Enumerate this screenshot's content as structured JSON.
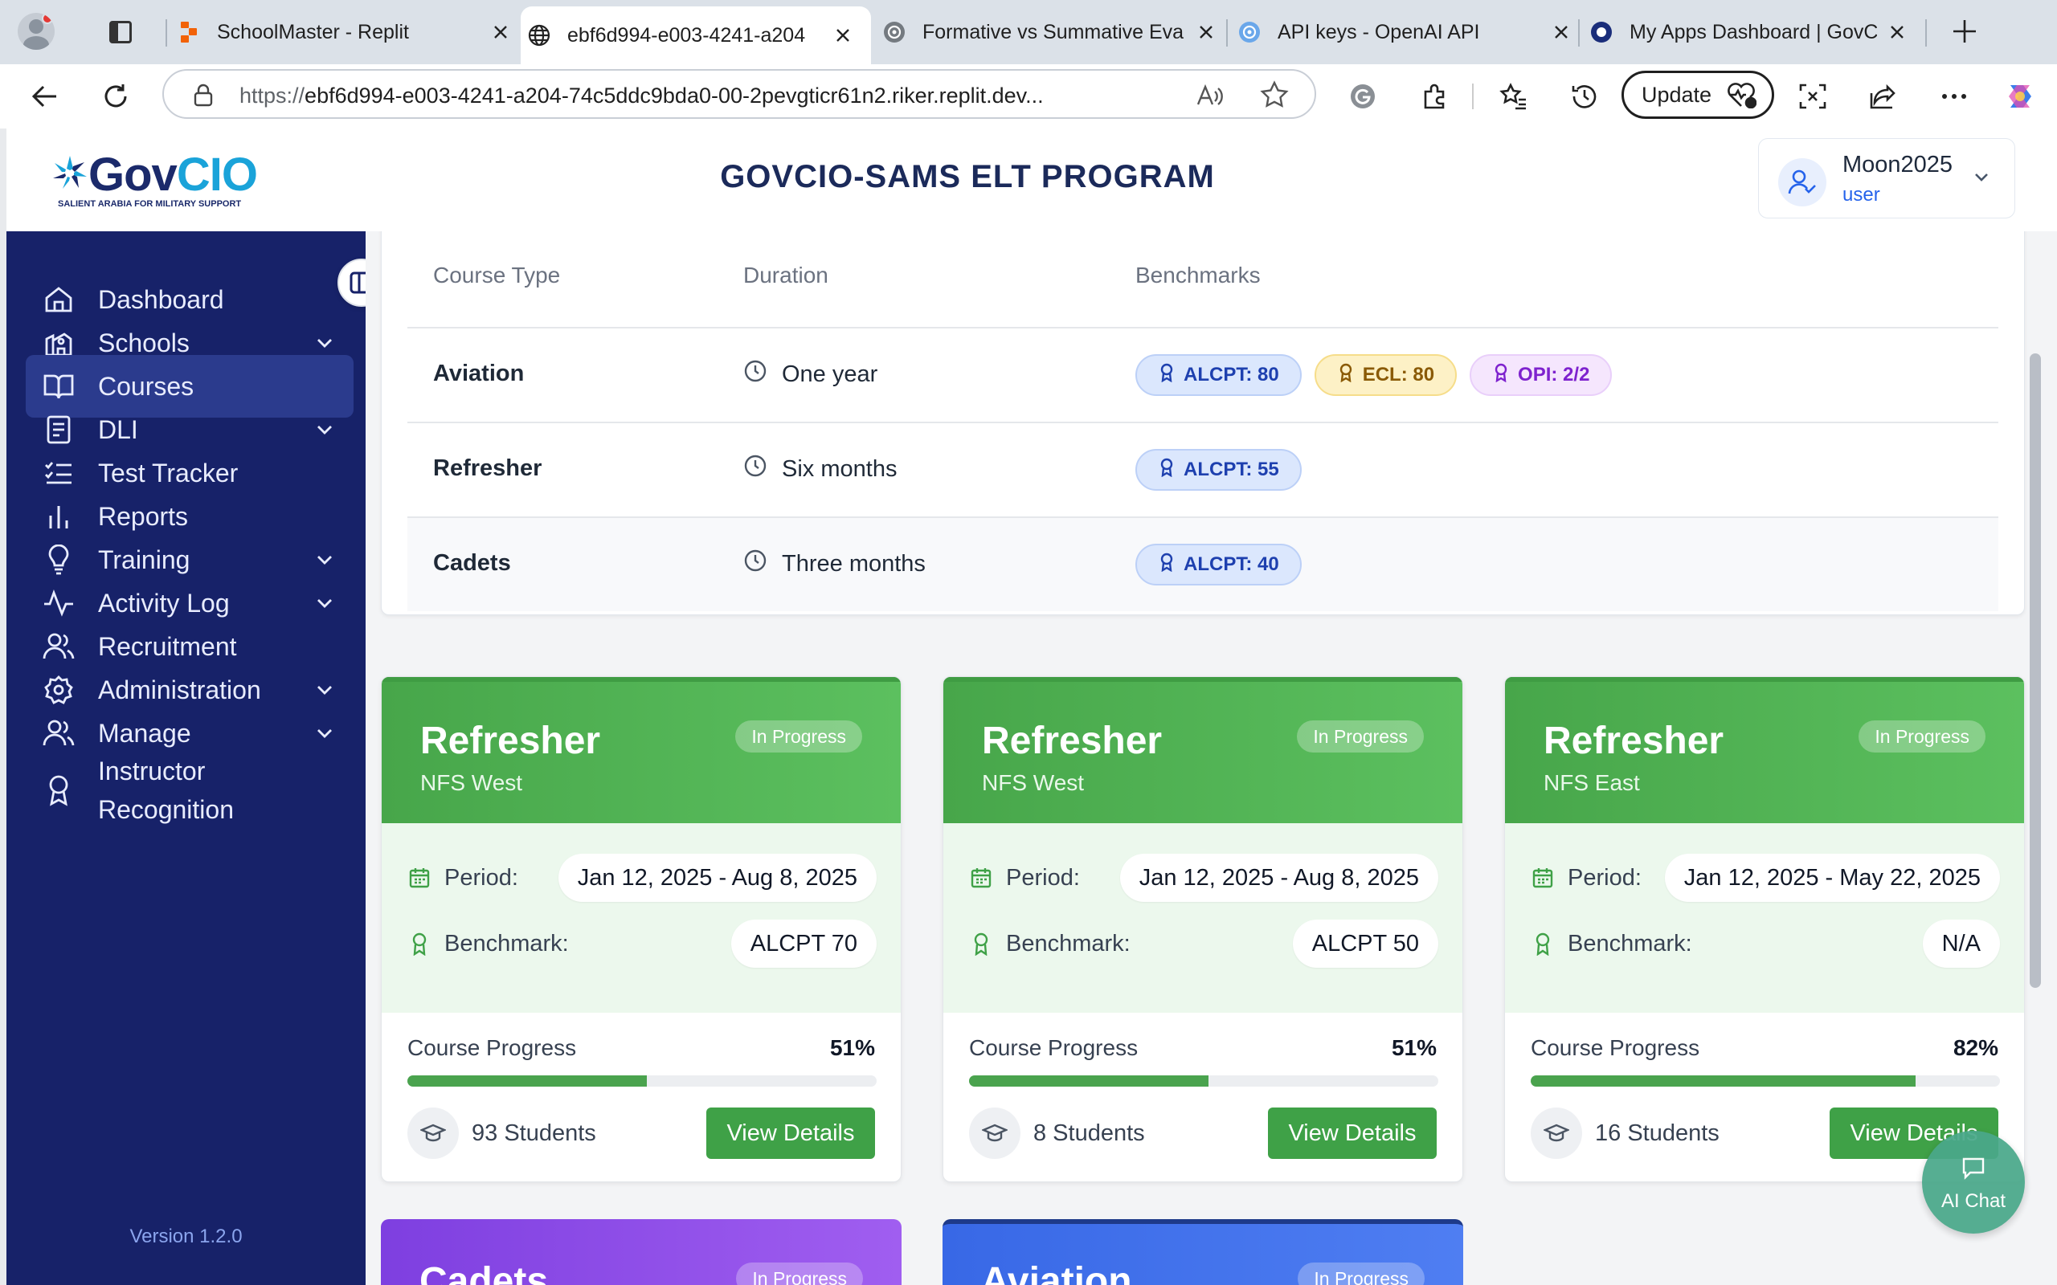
{
  "browser": {
    "tabs": [
      {
        "title": "SchoolMaster - Replit",
        "icon": "replit-icon"
      },
      {
        "title": "ebf6d994-e003-4241-a204",
        "icon": "globe-icon"
      },
      {
        "title": "Formative vs Summative Eva",
        "icon": "openai-icon"
      },
      {
        "title": "API keys - OpenAI API",
        "icon": "openai-icon"
      },
      {
        "title": "My Apps Dashboard | GovCI",
        "icon": "okta-icon"
      }
    ],
    "url_prefix": "https://",
    "url_host": "ebf6d994-e003-4241-a204-74c5ddc9bda0-00-2pevgticr61n2.riker.replit.dev...",
    "update_label": "Update"
  },
  "header": {
    "logo_text_a": "Gov",
    "logo_text_b": "CIO",
    "logo_tagline": "SALIENT ARABIA FOR MILITARY SUPPORT",
    "title": "GOVCIO-SAMS ELT PROGRAM",
    "user_name": "Moon2025",
    "user_role": "user"
  },
  "sidebar": {
    "items": [
      {
        "label": "Dashboard",
        "icon": "home-icon",
        "dropdown": false
      },
      {
        "label": "Schools",
        "icon": "school-icon",
        "dropdown": true
      },
      {
        "label": "Courses",
        "icon": "book-icon",
        "dropdown": false,
        "active": true
      },
      {
        "label": "DLI",
        "icon": "notebook-icon",
        "dropdown": true
      },
      {
        "label": "Test Tracker",
        "icon": "checklist-icon",
        "dropdown": false
      },
      {
        "label": "Reports",
        "icon": "bar-chart-icon",
        "dropdown": false
      },
      {
        "label": "Training",
        "icon": "lightbulb-icon",
        "dropdown": true
      },
      {
        "label": "Activity Log",
        "icon": "activity-icon",
        "dropdown": true
      },
      {
        "label": "Recruitment",
        "icon": "users-icon",
        "dropdown": false
      },
      {
        "label": "Administration",
        "icon": "gear-icon",
        "dropdown": true
      },
      {
        "label": "Manage",
        "icon": "users-icon",
        "dropdown": true
      },
      {
        "label_line1": "Instructor",
        "label_line2": "Recognition",
        "icon": "award-icon",
        "dropdown": false
      }
    ],
    "version": "Version 1.2.0"
  },
  "course_table": {
    "headers": [
      "Course Type",
      "Duration",
      "Benchmarks"
    ],
    "rows": [
      {
        "type": "Aviation",
        "duration": "One year",
        "benchmarks": [
          "ALCPT: 80",
          "ECL: 80",
          "OPI: 2/2"
        ]
      },
      {
        "type": "Refresher",
        "duration": "Six months",
        "benchmarks": [
          "ALCPT: 55"
        ]
      },
      {
        "type": "Cadets",
        "duration": "Three months",
        "benchmarks": [
          "ALCPT: 40"
        ]
      }
    ]
  },
  "courses": [
    {
      "name": "Refresher",
      "location": "NFS West",
      "status": "In Progress",
      "period_label": "Period:",
      "period": "Jan 12, 2025 - Aug 8, 2025",
      "benchmark_label": "Benchmark:",
      "benchmark": "ALCPT 70",
      "progress_label": "Course Progress",
      "progress_text": "51%",
      "progress": 0.51,
      "students": "93 Students",
      "button": "View Details"
    },
    {
      "name": "Refresher",
      "location": "NFS West",
      "status": "In Progress",
      "period_label": "Period:",
      "period": "Jan 12, 2025 - Aug 8, 2025",
      "benchmark_label": "Benchmark:",
      "benchmark": "ALCPT 50",
      "progress_label": "Course Progress",
      "progress_text": "51%",
      "progress": 0.51,
      "students": "8 Students",
      "button": "View Details"
    },
    {
      "name": "Refresher",
      "location": "NFS East",
      "status": "In Progress",
      "period_label": "Period:",
      "period": "Jan 12, 2025 - May 22, 2025",
      "benchmark_label": "Benchmark:",
      "benchmark": "N/A",
      "progress_label": "Course Progress",
      "progress_text": "82%",
      "progress": 0.82,
      "students": "16 Students",
      "button": "View Details"
    }
  ],
  "partial_courses": [
    {
      "name": "Cadets",
      "status": "In Progress",
      "color_from": "#7e3fe0",
      "color_to": "#a05ef0"
    },
    {
      "name": "Aviation",
      "status": "In Progress",
      "color_from": "#3868e6",
      "color_to": "#4f7ef2"
    }
  ],
  "ai_chat": {
    "label": "AI Chat"
  },
  "colors": {
    "sidebar": "#172269",
    "card_header": "#4caf50",
    "accent": "#2563eb"
  }
}
